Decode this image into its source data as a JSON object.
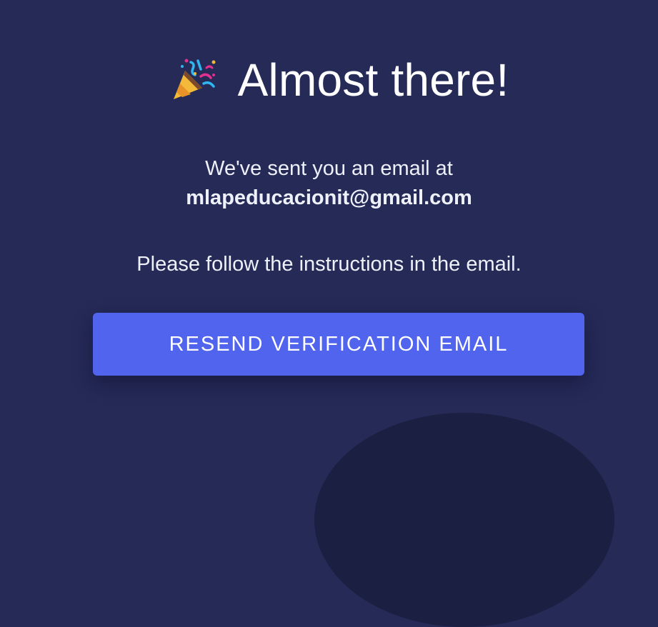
{
  "heading": {
    "icon": "party-popper-icon",
    "title": "Almost there!"
  },
  "message": {
    "line1": "We've sent you an email at",
    "email": "mlapeducacionit@gmail.com",
    "line2": "Please follow the instructions in the email."
  },
  "actions": {
    "resend_label": "RESEND VERIFICATION EMAIL"
  },
  "colors": {
    "background": "#252a57",
    "button": "#5064ee",
    "text": "#ffffff"
  }
}
